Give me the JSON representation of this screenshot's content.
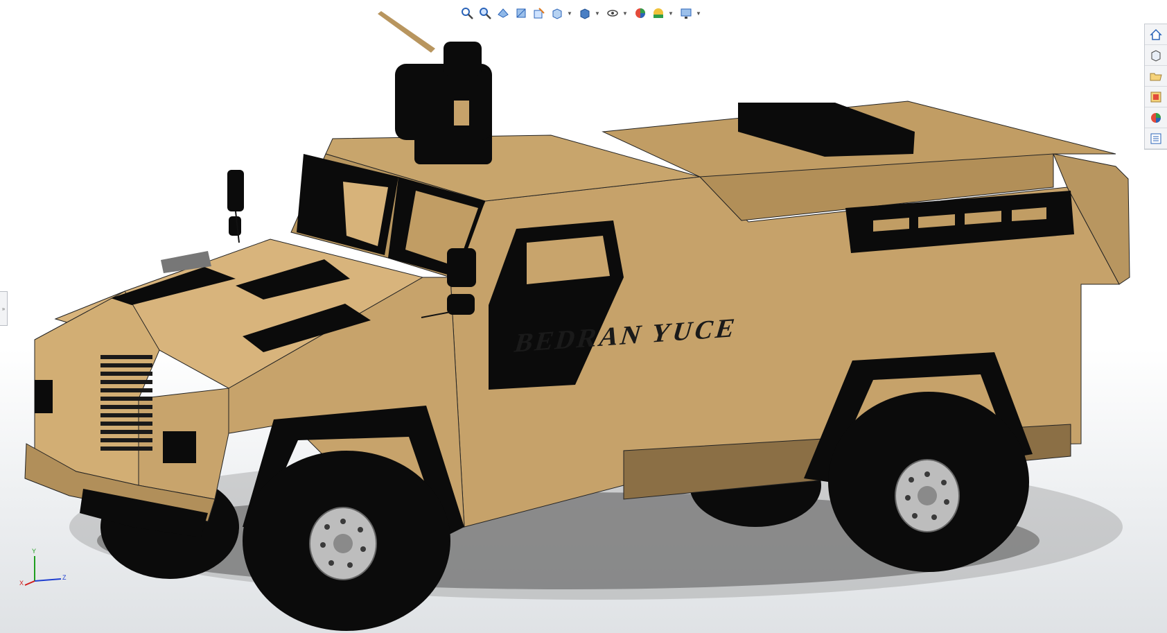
{
  "heads_up_toolbar": {
    "buttons": [
      {
        "icon": "zoom-to-fit-icon",
        "dropdown": false
      },
      {
        "icon": "zoom-to-area-icon",
        "dropdown": false
      },
      {
        "icon": "previous-view-icon",
        "dropdown": false
      },
      {
        "icon": "section-view-icon",
        "dropdown": false
      },
      {
        "icon": "dynamic-annotation-views-icon",
        "dropdown": false
      },
      {
        "icon": "view-orientation-icon",
        "dropdown": true
      },
      {
        "icon": "display-style-icon",
        "dropdown": true
      },
      {
        "icon": "hide-show-items-icon",
        "dropdown": true
      },
      {
        "icon": "edit-appearance-icon",
        "dropdown": false
      },
      {
        "icon": "apply-scene-icon",
        "dropdown": true
      },
      {
        "icon": "view-settings-icon",
        "dropdown": true
      }
    ]
  },
  "task_pane": {
    "tabs": [
      {
        "icon": "solidworks-resources-icon"
      },
      {
        "icon": "design-library-icon"
      },
      {
        "icon": "file-explorer-icon"
      },
      {
        "icon": "view-palette-icon"
      },
      {
        "icon": "appearances-scenes-icon"
      },
      {
        "icon": "custom-properties-icon"
      }
    ]
  },
  "model": {
    "side_lettering": "BEDRAN YUCE",
    "colors": {
      "body": "#c6a26a",
      "body_light": "#d8b47c",
      "body_top": "#c19d64",
      "body_dark": "#7c643f",
      "black_parts": "#0b0b0b",
      "hub": "#bdbdbd"
    }
  },
  "triad": {
    "x_label": "X",
    "y_label": "Y",
    "z_label": "Z",
    "colors": {
      "x": "#d01c1c",
      "y": "#1f9e1f",
      "z": "#1f3fd0"
    }
  },
  "flyout_handle": {
    "glyph": "»"
  }
}
